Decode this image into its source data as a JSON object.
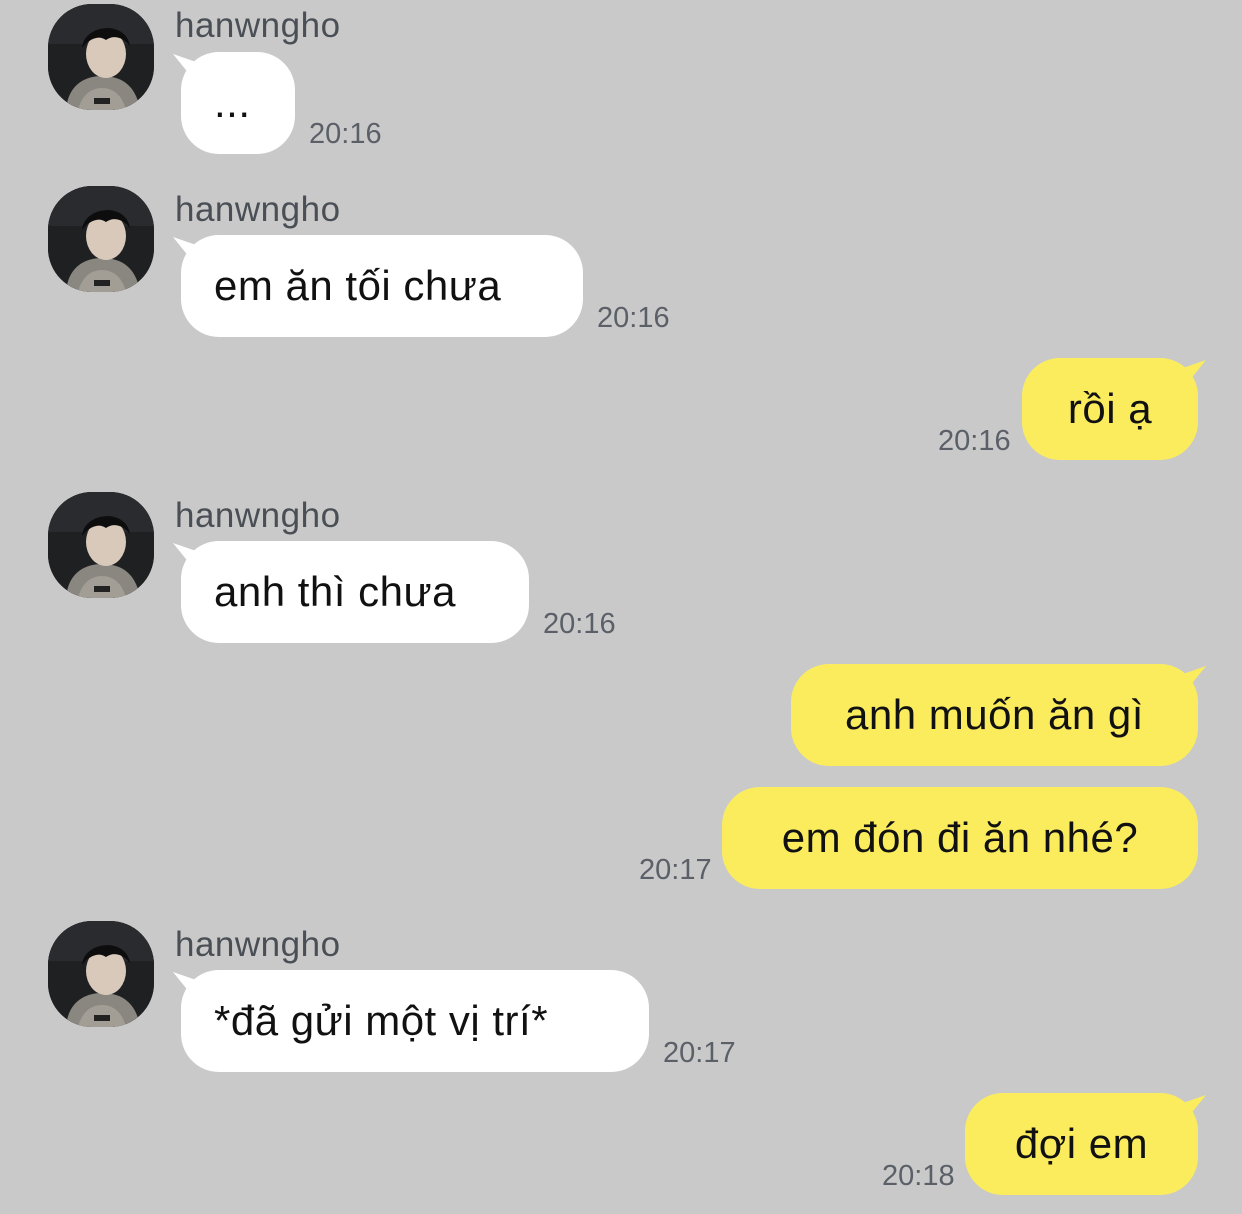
{
  "chat": {
    "sender_name": "hanwngho",
    "messages": [
      {
        "direction": "incoming",
        "text": "...",
        "time": "20:16"
      },
      {
        "direction": "incoming",
        "text": "em ăn tối chưa",
        "time": "20:16"
      },
      {
        "direction": "outgoing",
        "text": "rồi ạ",
        "time": "20:16"
      },
      {
        "direction": "incoming",
        "text": "anh thì chưa",
        "time": "20:16"
      },
      {
        "direction": "outgoing",
        "text": "anh muốn ăn gì",
        "time": ""
      },
      {
        "direction": "outgoing",
        "text": "em đón đi ăn nhé?",
        "time": "20:17"
      },
      {
        "direction": "incoming",
        "text": "*đã gửi một vị trí*",
        "time": "20:17"
      },
      {
        "direction": "outgoing",
        "text": "đợi em",
        "time": "20:18"
      }
    ]
  },
  "colors": {
    "background": "#c9c9c9",
    "incoming_bubble": "#ffffff",
    "outgoing_bubble": "#fbec5d",
    "timestamp": "#5b6068",
    "sender_name": "#4a4f55"
  },
  "icons": {
    "avatar": "profile-photo"
  }
}
